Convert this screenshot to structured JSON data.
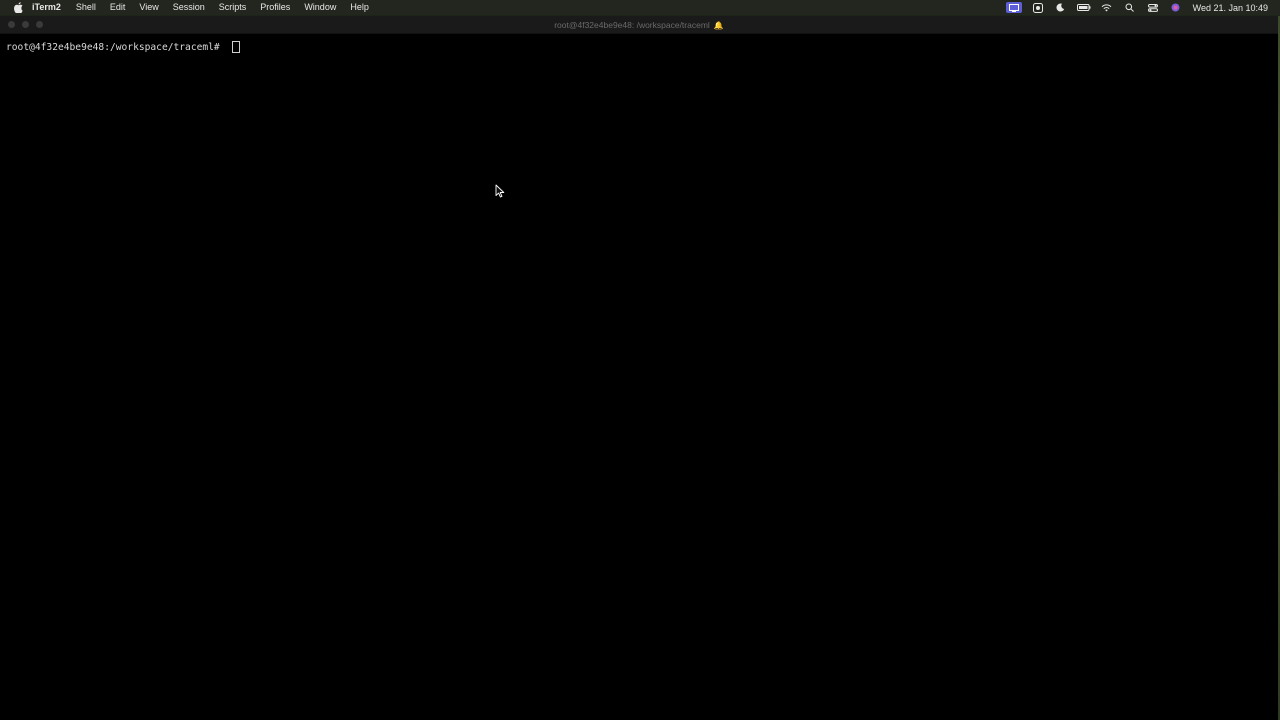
{
  "menubar": {
    "app_name": "iTerm2",
    "menus": [
      "Shell",
      "Edit",
      "View",
      "Session",
      "Scripts",
      "Profiles",
      "Window",
      "Help"
    ],
    "clock": "Wed 21. Jan  10:49"
  },
  "window": {
    "title": "root@4f32e4be9e48: /workspace/traceml",
    "bell": "🔔"
  },
  "terminal": {
    "prompt": "root@4f32e4be9e48:/workspace/traceml# ",
    "input": ""
  },
  "colors": {
    "terminal_bg": "#000000",
    "menubar_bg": "#23261e",
    "active_status_icon": "#5c5fd6"
  }
}
